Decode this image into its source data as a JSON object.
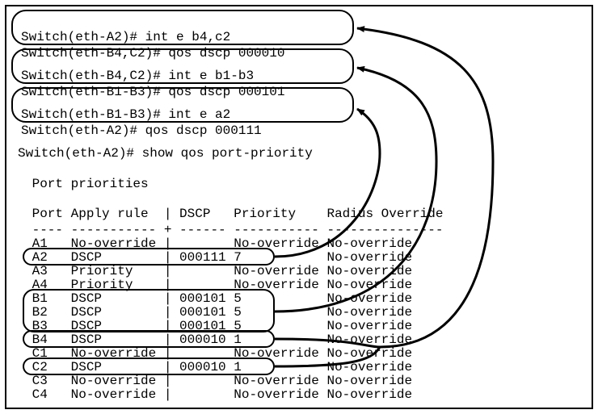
{
  "commands": {
    "block1": {
      "line1": "Switch(eth-A2)# int e b4,c2",
      "line2": "Switch(eth-B4,C2)# qos dscp 000010"
    },
    "block2": {
      "line1": "Switch(eth-B4,C2)# int e b1-b3",
      "line2": "Switch(eth-B1-B3)# qos dscp 000101"
    },
    "block3": {
      "line1": "Switch(eth-B1-B3)# int e a2",
      "line2": "Switch(eth-A2)# qos dscp 000111"
    }
  },
  "show_cmd": "Switch(eth-A2)# show qos port-priority",
  "section_title": " Port priorities",
  "header": " Port Apply rule  | DSCP   Priority    Radius Override",
  "divider": " ---- ----------- + ------ ----------- ---------------",
  "rows": {
    "r0": " A1   No-override |        No-override No-override",
    "r1": " A2   DSCP        | 000111 7           No-override",
    "r2": " A3   Priority    |        No-override No-override",
    "r3": " A4   Priority    |        No-override No-override",
    "r4": " B1   DSCP        | 000101 5           No-override",
    "r5": " B2   DSCP        | 000101 5           No-override",
    "r6": " B3   DSCP        | 000101 5           No-override",
    "r7": " B4   DSCP        | 000010 1           No-override",
    "r8": " C1   No-override |        No-override No-override",
    "r9": " C2   DSCP        | 000010 1           No-override",
    "r10": " C3   No-override |        No-override No-override",
    "r11": " C4   No-override |        No-override No-override"
  },
  "chart_data": {
    "type": "table",
    "title": "Port priorities",
    "columns": [
      "Port",
      "Apply rule",
      "DSCP",
      "Priority",
      "Radius Override"
    ],
    "rows": [
      [
        "A1",
        "No-override",
        "",
        "No-override",
        "No-override"
      ],
      [
        "A2",
        "DSCP",
        "000111",
        "7",
        "No-override"
      ],
      [
        "A3",
        "Priority",
        "",
        "No-override",
        "No-override"
      ],
      [
        "A4",
        "Priority",
        "",
        "No-override",
        "No-override"
      ],
      [
        "B1",
        "DSCP",
        "000101",
        "5",
        "No-override"
      ],
      [
        "B2",
        "DSCP",
        "000101",
        "5",
        "No-override"
      ],
      [
        "B3",
        "DSCP",
        "000101",
        "5",
        "No-override"
      ],
      [
        "B4",
        "DSCP",
        "000010",
        "1",
        "No-override"
      ],
      [
        "C1",
        "No-override",
        "",
        "No-override",
        "No-override"
      ],
      [
        "C2",
        "DSCP",
        "000010",
        "1",
        "No-override"
      ],
      [
        "C3",
        "No-override",
        "",
        "No-override",
        "No-override"
      ],
      [
        "C4",
        "No-override",
        "",
        "No-override",
        "No-override"
      ]
    ],
    "command_mappings": [
      {
        "command": "qos dscp 000010",
        "interfaces": [
          "B4",
          "C2"
        ],
        "dscp": "000010",
        "priority": 1
      },
      {
        "command": "qos dscp 000101",
        "interfaces": [
          "B1",
          "B2",
          "B3"
        ],
        "dscp": "000101",
        "priority": 5
      },
      {
        "command": "qos dscp 000111",
        "interfaces": [
          "A2"
        ],
        "dscp": "000111",
        "priority": 7
      }
    ]
  }
}
